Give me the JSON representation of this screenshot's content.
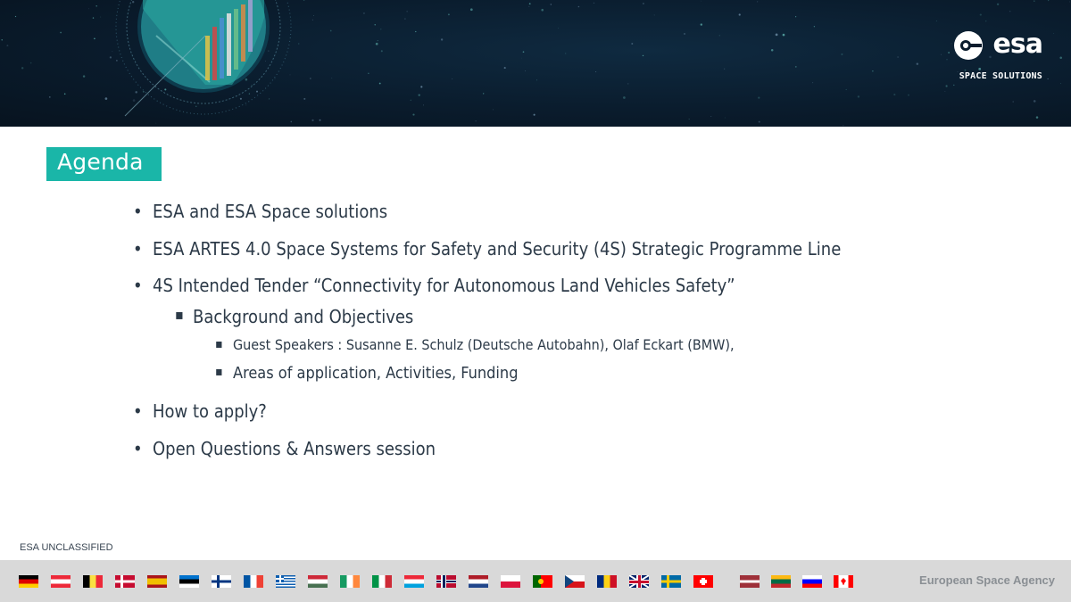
{
  "header": {
    "logo_text": "esa",
    "logo_subtitle": "SPACE SOLUTIONS"
  },
  "slide": {
    "title": "Agenda",
    "items": [
      {
        "level": 1,
        "text": "ESA and ESA Space solutions"
      },
      {
        "level": 1,
        "text": "ESA ARTES 4.0 Space Systems for Safety and Security (4S) Strategic Programme Line"
      },
      {
        "level": 1,
        "text": "4S Intended Tender “Connectivity for Autonomous Land Vehicles Safety”"
      },
      {
        "level": 2,
        "text": "Background and Objectives"
      },
      {
        "level": 3,
        "text": "Guest Speakers : Susanne E. Schulz (Deutsche Autobahn), Olaf Eckart (BMW),"
      },
      {
        "level": 3,
        "text": "Areas of application, Activities, Funding"
      },
      {
        "level": 1,
        "text": "How to apply?"
      },
      {
        "level": 1,
        "text": "Open Questions & Answers session"
      }
    ]
  },
  "footer": {
    "classification": "ESA UNCLASSIFIED",
    "agency": "European Space Agency",
    "flags": [
      "germany-flag",
      "austria-flag",
      "belgium-flag",
      "denmark-flag",
      "spain-flag",
      "estonia-flag",
      "finland-flag",
      "france-flag",
      "greece-flag",
      "hungary-flag",
      "ireland-flag",
      "italy-flag",
      "luxembourg-flag",
      "norway-flag",
      "netherlands-flag",
      "poland-flag",
      "portugal-flag",
      "czechia-flag",
      "romania-flag",
      "uk-flag",
      "sweden-flag",
      "switzerland-flag",
      "latvia-flag",
      "lithuania-flag",
      "slovenia-flag",
      "canada-flag"
    ]
  },
  "colors": {
    "accent": "#1ab6a8",
    "text": "#2c3a48",
    "banner": "#0a1c2d",
    "footer_bg": "#d9d9d9"
  }
}
